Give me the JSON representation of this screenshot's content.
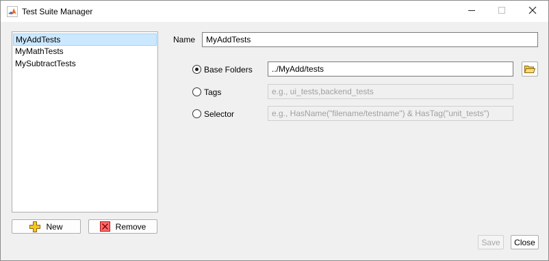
{
  "window": {
    "title": "Test Suite Manager",
    "minimize_icon": "minimize-icon",
    "maximize_icon": "maximize-icon",
    "close_icon": "close-icon"
  },
  "suites": {
    "items": [
      "MyAddTests",
      "MyMathTests",
      "MySubtractTests"
    ],
    "selected": "MyAddTests"
  },
  "buttons": {
    "new_label": "New",
    "remove_label": "Remove",
    "save_label": "Save",
    "close_label": "Close"
  },
  "form": {
    "name_label": "Name",
    "name_value": "MyAddTests",
    "base_folders_label": "Base Folders",
    "base_folders_value": "../MyAdd/tests",
    "tags_label": "Tags",
    "tags_placeholder": "e.g., ui_tests,backend_tests",
    "selector_label": "Selector",
    "selector_placeholder": "e.g., HasName(\"filename/testname\") & HasTag(\"unit_tests\")",
    "selected_option": "Base Folders"
  },
  "colors": {
    "selection": "#cce8ff",
    "add_icon": "#f7c325",
    "remove_icon": "#e23b3b",
    "folder_icon": "#f5c443"
  }
}
